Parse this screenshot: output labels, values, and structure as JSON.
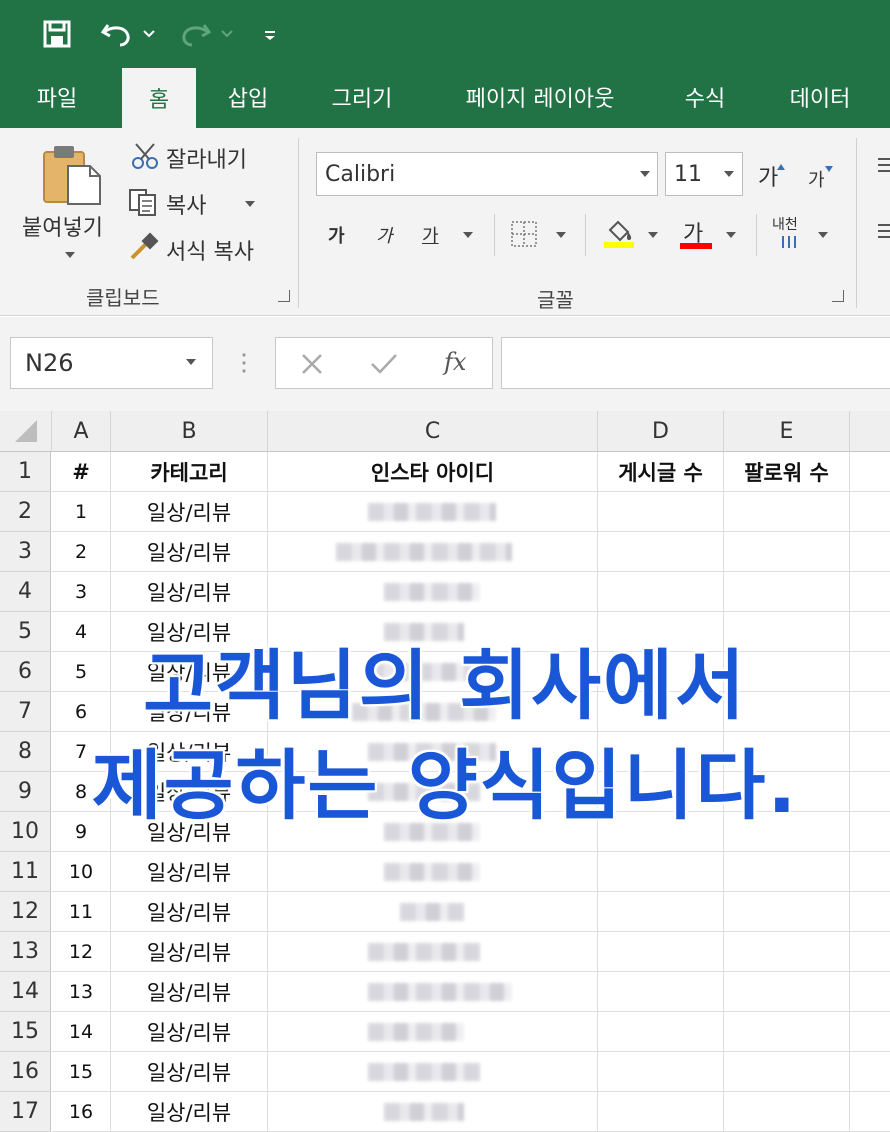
{
  "ribbon_tabs": [
    "파일",
    "홈",
    "삽입",
    "그리기",
    "페이지 레이아웃",
    "수식",
    "데이터"
  ],
  "active_tab": "홈",
  "clipboard": {
    "paste_label": "붙여넣기",
    "cut_label": "잘라내기",
    "copy_label": "복사",
    "format_painter_label": "서식 복사",
    "group_label": "클립보드"
  },
  "font": {
    "family_value": "Calibri",
    "size_value": "11",
    "grow_label": "가",
    "shrink_label": "가",
    "bold_label": "가",
    "italic_label": "가",
    "underline_label": "가",
    "font_color_label": "가",
    "phonetic_label": "내천",
    "group_label": "글꼴",
    "fill_color": "#ffff00",
    "font_color": "#ff0000"
  },
  "formula_bar": {
    "name_box": "N26",
    "fx_label": "fx",
    "formula_value": ""
  },
  "columns": [
    {
      "letter": "A",
      "header": "#"
    },
    {
      "letter": "B",
      "header": "카테고리"
    },
    {
      "letter": "C",
      "header": "인스타 아이디"
    },
    {
      "letter": "D",
      "header": "게시글 수"
    },
    {
      "letter": "E",
      "header": "팔로워 수"
    }
  ],
  "row_numbers": [
    "1",
    "2",
    "3",
    "4",
    "5",
    "6",
    "7",
    "8",
    "9",
    "10",
    "11",
    "12",
    "13",
    "14",
    "15",
    "16",
    "17"
  ],
  "rows": [
    {
      "num": "1",
      "category": "일상/리뷰"
    },
    {
      "num": "2",
      "category": "일상/리뷰"
    },
    {
      "num": "3",
      "category": "일상/리뷰"
    },
    {
      "num": "4",
      "category": "일상/리뷰"
    },
    {
      "num": "5",
      "category": "일상/리뷰"
    },
    {
      "num": "6",
      "category": "일상/리뷰"
    },
    {
      "num": "7",
      "category": "일상/리뷰"
    },
    {
      "num": "8",
      "category": "일상/리뷰"
    },
    {
      "num": "9",
      "category": "일상/리뷰"
    },
    {
      "num": "10",
      "category": "일상/리뷰"
    },
    {
      "num": "11",
      "category": "일상/리뷰"
    },
    {
      "num": "12",
      "category": "일상/리뷰"
    },
    {
      "num": "13",
      "category": "일상/리뷰"
    },
    {
      "num": "14",
      "category": "일상/리뷰"
    },
    {
      "num": "15",
      "category": "일상/리뷰"
    },
    {
      "num": "16",
      "category": "일상/리뷰"
    }
  ],
  "overlay": {
    "line1": "고객님의 회사에서",
    "line2": "제공하는 양식입니다.",
    "color": "#1a57d6"
  },
  "colors": {
    "excel_green": "#217346",
    "ribbon_bg": "#f3f3f3"
  }
}
